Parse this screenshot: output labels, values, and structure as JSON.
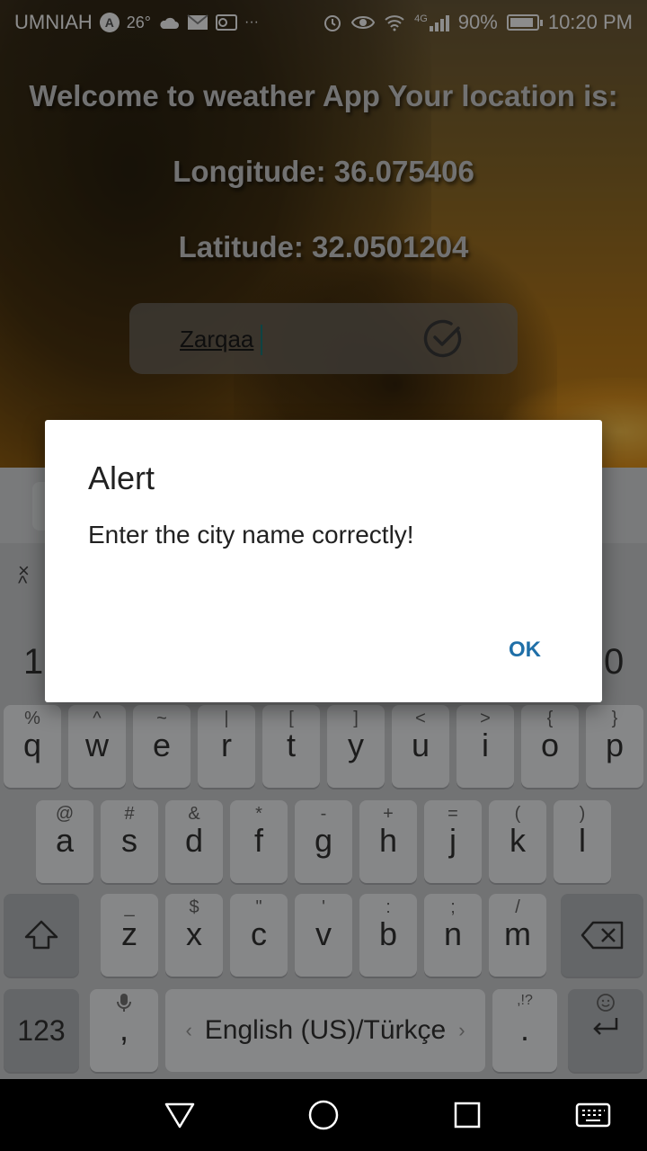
{
  "status_bar": {
    "carrier": "UMNIAH",
    "carrier_badge": "A",
    "temperature": "26°",
    "network_type": "4G",
    "battery_percent": "90%",
    "battery_level": 0.9,
    "time": "10:20 PM"
  },
  "app": {
    "welcome_text": "Welcome to weather App  Your location is:",
    "longitude_text": "Longitude: 36.075406",
    "latitude_text": "Latitude: 32.0501204",
    "city_input_value": "Zarqaa"
  },
  "dialog": {
    "title": "Alert",
    "message": "Enter the city name correctly!",
    "ok_label": "OK"
  },
  "keyboard": {
    "number_row_visible": [
      "1",
      "0"
    ],
    "row1": [
      {
        "main": "q",
        "sub": "%"
      },
      {
        "main": "w",
        "sub": "^"
      },
      {
        "main": "e",
        "sub": "~"
      },
      {
        "main": "r",
        "sub": "|"
      },
      {
        "main": "t",
        "sub": "["
      },
      {
        "main": "y",
        "sub": "]"
      },
      {
        "main": "u",
        "sub": "<"
      },
      {
        "main": "i",
        "sub": ">"
      },
      {
        "main": "o",
        "sub": "{"
      },
      {
        "main": "p",
        "sub": "}"
      }
    ],
    "row2": [
      {
        "main": "a",
        "sub": "@"
      },
      {
        "main": "s",
        "sub": "#"
      },
      {
        "main": "d",
        "sub": "&"
      },
      {
        "main": "f",
        "sub": "*"
      },
      {
        "main": "g",
        "sub": "-"
      },
      {
        "main": "h",
        "sub": "+"
      },
      {
        "main": "j",
        "sub": "="
      },
      {
        "main": "k",
        "sub": "("
      },
      {
        "main": "l",
        "sub": ")"
      }
    ],
    "row3": [
      {
        "main": "z",
        "sub": "_"
      },
      {
        "main": "x",
        "sub": "$"
      },
      {
        "main": "c",
        "sub": "\""
      },
      {
        "main": "v",
        "sub": "'"
      },
      {
        "main": "b",
        "sub": ":"
      },
      {
        "main": "n",
        "sub": ";"
      },
      {
        "main": "m",
        "sub": "/"
      }
    ],
    "symbols_key": "123",
    "comma_key": ",",
    "period_key": ".",
    "period_sub": ",!?",
    "space_label": "English (US)/Türkçe"
  },
  "icons": {
    "check": "check-circle-icon",
    "shift": "shift-icon",
    "backspace": "backspace-icon",
    "enter": "enter-icon",
    "mic": "mic-icon",
    "emoji": "emoji-icon",
    "back": "nav-back-icon",
    "home": "nav-home-icon",
    "recents": "nav-recents-icon",
    "keyboard": "keyboard-switch-icon"
  },
  "colors": {
    "dialog_accent": "#1f6fa8",
    "cursor": "#1a7a7a"
  }
}
